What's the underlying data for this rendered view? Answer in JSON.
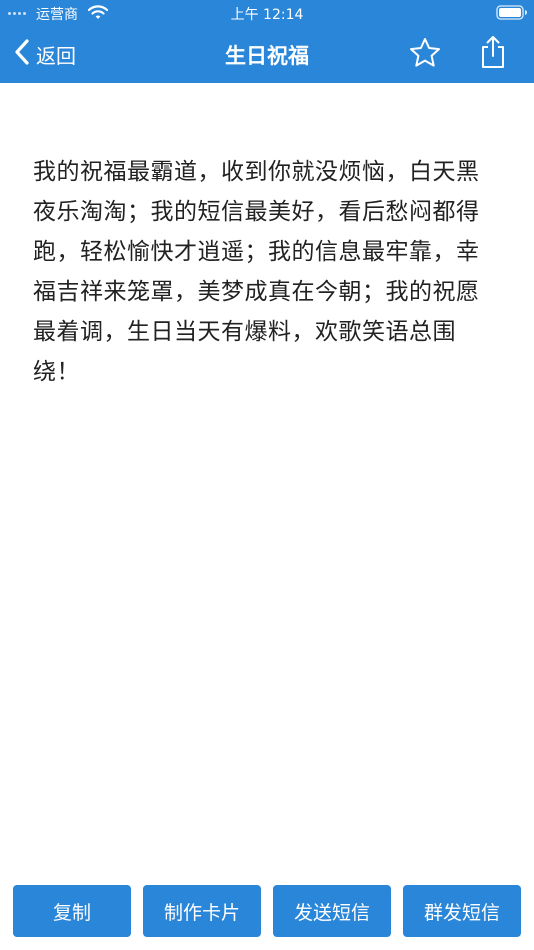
{
  "status_bar": {
    "carrier": "运营商",
    "time": "上午 12:14",
    "signal_icon": "signal-dots-icon",
    "wifi_icon": "wifi-icon",
    "battery_icon": "battery-icon"
  },
  "nav": {
    "back_label": "返回",
    "title": "生日祝福",
    "favorite_icon": "star-icon",
    "share_icon": "share-icon"
  },
  "content": {
    "message": "我的祝福最霸道，收到你就没烦恼，白天黑夜乐淘淘；我的短信最美好，看后愁闷都得跑，轻松愉快才逍遥；我的信息最牢靠，幸福吉祥来笼罩，美梦成真在今朝；我的祝愿最着调，生日当天有爆料，欢歌笑语总围绕！"
  },
  "actions": {
    "copy": "复制",
    "make_card": "制作卡片",
    "send_sms": "发送短信",
    "group_send_sms": "群发短信"
  },
  "colors": {
    "primary": "#2a86d8",
    "text": "#222222",
    "background": "#ffffff"
  }
}
